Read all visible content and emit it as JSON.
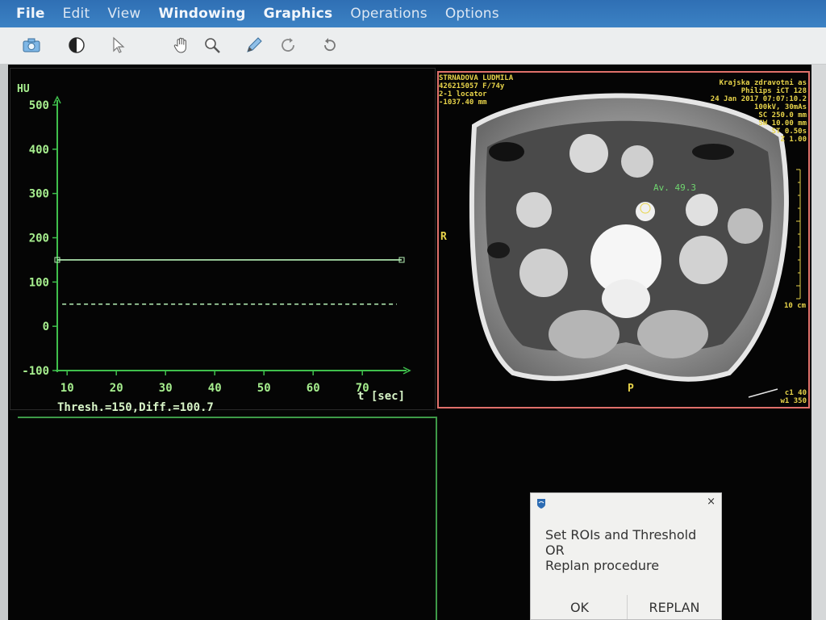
{
  "menu": [
    "File",
    "Edit",
    "View",
    "Windowing",
    "Graphics",
    "Operations",
    "Options"
  ],
  "toolbar": {
    "tools": [
      "camera-icon",
      "contrast-icon",
      "pointer-icon",
      "hand-icon",
      "zoom-icon",
      "pen-icon",
      "rotate-icon",
      "reset-icon"
    ]
  },
  "graph": {
    "ylabel": "HU",
    "xlabel": "t [sec]",
    "status": "Thresh.=150,Diff.=100.7",
    "colors": {
      "axis": "#3fbf4c",
      "line": "#b6f1b6",
      "text": "#a6ee8e",
      "frame": "#3e9a48"
    }
  },
  "chart_data": {
    "type": "line",
    "ylabel": "HU",
    "xlabel": "t [sec]",
    "ylim": [
      -100,
      500
    ],
    "xlim": [
      8,
      78
    ],
    "xticks": [
      10,
      20,
      30,
      40,
      50,
      60,
      70
    ],
    "yticks": [
      -100,
      0,
      100,
      200,
      300,
      400,
      500
    ],
    "ytick_labels": [
      "-100",
      "0",
      "100",
      "200",
      "300",
      "400",
      "500"
    ],
    "series": [
      {
        "style": "solid",
        "x": [
          8,
          78
        ],
        "y": [
          150,
          150
        ]
      },
      {
        "style": "dashed",
        "x": [
          9,
          77
        ],
        "y": [
          50,
          50
        ]
      }
    ],
    "annotation": "Thresh.=150,Diff.=100.7"
  },
  "ct": {
    "patient": "STRNADOVA LUDMILA",
    "id_line": "426215057 F/74y",
    "series": "2-1 locator",
    "position": "-1037.40 mm",
    "hospital": "Krajska zdravotni as",
    "scanner": "Philips iCT 128",
    "datetime": "24 Jan 2017 07:07:10.2",
    "kv": "100kV, 30mAs",
    "sc": "SC 250.0 mm",
    "sw": "SW 10.00 mm",
    "st": "ST 0.50s",
    "z": "Z 1.00",
    "roi_label": "Av. 49.3",
    "scale_label": "10 cm",
    "wc": "c1 40",
    "ww": "w1 350",
    "orient_r": "R",
    "orient_p": "P",
    "colors": {
      "overlay": "#e8d44a",
      "border": "#e0706a",
      "roi": "#6fd66f"
    }
  },
  "dialog": {
    "lines": [
      "Set ROIs and Threshold",
      "OR",
      "Replan procedure"
    ],
    "ok": "OK",
    "replan": "REPLAN",
    "close": "×"
  }
}
